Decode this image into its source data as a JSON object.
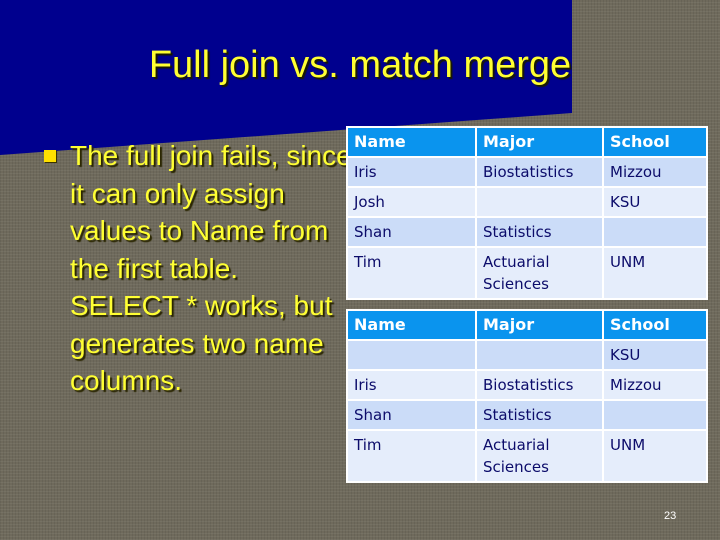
{
  "slide": {
    "title": "Full join vs. match merge",
    "bullet": "The full join fails, since it can only assign values to Name from the first table. SELECT * works, but generates two name columns.",
    "page_number": "23",
    "colors": {
      "title_band": "#00008b",
      "text": "#ffff33",
      "table_header": "#0a94ee",
      "row_odd": "#cbdcf8",
      "row_even": "#e5edfb"
    }
  },
  "table1": {
    "headers": [
      "Name",
      "Major",
      "School"
    ],
    "rows": [
      [
        "Iris",
        "Biostatistics",
        "Mizzou"
      ],
      [
        "Josh",
        "",
        "KSU"
      ],
      [
        "Shan",
        "Statistics",
        ""
      ],
      [
        "Tim",
        "Actuarial Sciences",
        "UNM"
      ]
    ]
  },
  "table2": {
    "headers": [
      "Name",
      "Major",
      "School"
    ],
    "rows": [
      [
        "",
        "",
        "KSU"
      ],
      [
        "Iris",
        "Biostatistics",
        "Mizzou"
      ],
      [
        "Shan",
        "Statistics",
        ""
      ],
      [
        "Tim",
        "Actuarial Sciences",
        "UNM"
      ]
    ]
  }
}
